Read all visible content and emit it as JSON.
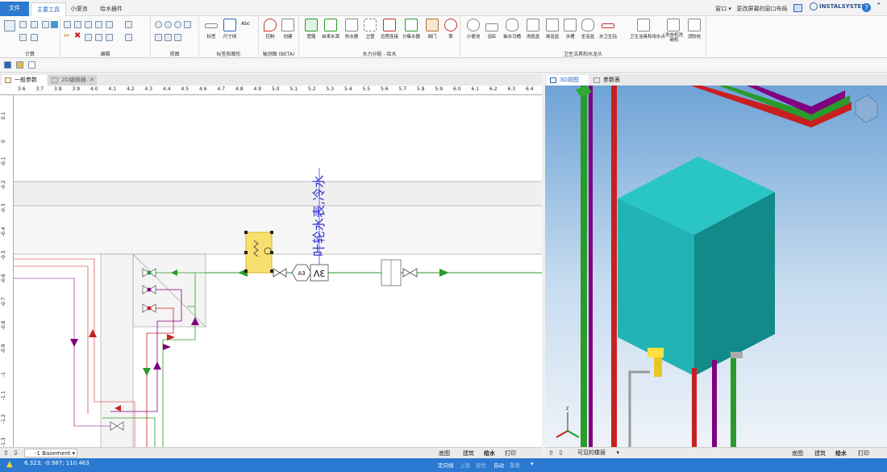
{
  "tabs": {
    "file": "文件",
    "main": "主要工具",
    "small": "小便池",
    "water": "给水器件"
  },
  "titlebar": {
    "window": "窗口 ▾",
    "layout": "更改屏幕的窗口布局 ▾",
    "brand": "INSTALSYSTEM"
  },
  "ribbon": {
    "groups": [
      "计算",
      "编辑",
      "视图",
      "标签和图形",
      "轴测图 (BETA)",
      "水力分配 - 给水",
      "卫生洁具和水龙头"
    ],
    "buttons": [
      "标签",
      "尺寸线",
      "控制",
      "创建",
      "管路",
      "自来水源",
      "热水器",
      "立管",
      "远程连接",
      "分集水器",
      "阀门",
      "泵",
      "小便池",
      "浴缸",
      "抽水马桶",
      "洗脸盆",
      "淋浴盆",
      "水槽",
      "坐浴盆",
      "水卫生钻",
      "卫生洁具和用水点",
      "洗衣机洗碗机",
      "消防栓"
    ]
  },
  "doc_tabs": {
    "params": "一般参数",
    "editor": "2D编辑器",
    "view3d": "3D视图",
    "params3d": "参数表"
  },
  "ruler_top": [
    "3.6",
    "3.7",
    "3.8",
    "3.9",
    "4.0",
    "4.1",
    "4.2",
    "4.3",
    "4.4",
    "4.5",
    "4.6",
    "4.7",
    "4.8",
    "4.9",
    "5.0",
    "5.1",
    "5.2",
    "5.3",
    "5.4",
    "5.5",
    "5.6",
    "5.7",
    "5.8",
    "5.9",
    "6.0",
    "6.1",
    "6.2",
    "6.3",
    "6.4"
  ],
  "ruler_left": [
    "0.1",
    "0",
    "-0.1",
    "-0.2",
    "-0.3",
    "-0.4",
    "-0.5",
    "-0.6",
    "-0.7",
    "-0.8",
    "-0.9",
    "-1",
    "-1.1",
    "-1.2",
    "-1.3"
  ],
  "canvas": {
    "vertical_label": "叶轮水表,冷水",
    "box_label": "ΛƐ",
    "hex_label": "A3"
  },
  "floor_selector": "-1 Basement",
  "visible_floors": "可见的楼层",
  "view_tabs": [
    "底图",
    "建筑",
    "给水",
    "打印"
  ],
  "status": {
    "coords": "6.323; -0.987; 110.463",
    "snap": "定向线",
    "on": "上锁",
    "ortho": "极性",
    "auto": "自动",
    "grid": "重要"
  }
}
